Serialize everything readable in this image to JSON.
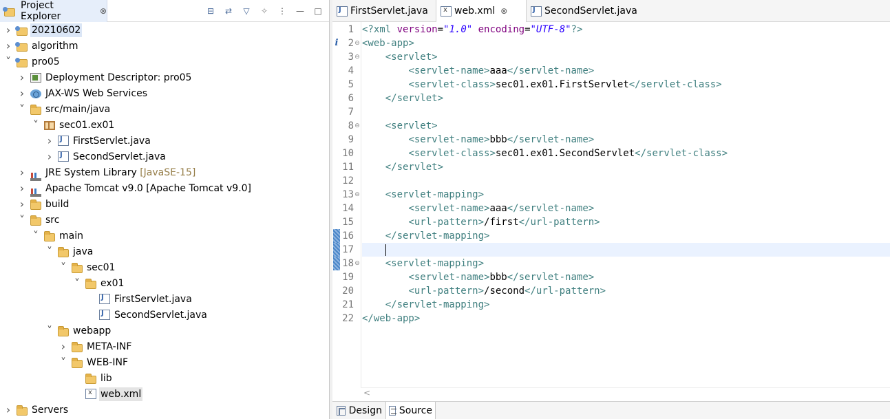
{
  "explorer": {
    "title": "Project Explorer",
    "close_glyph": "⊗",
    "toolbar": [
      "collapse-all-icon",
      "link-with-editor-icon",
      "filter-icon",
      "settings-icon",
      "view-menu-icon",
      "minimize-icon",
      "maximize-icon"
    ],
    "tree": [
      {
        "depth": 0,
        "chev": ">",
        "icon": "project",
        "label": "20210602",
        "sel": "blue"
      },
      {
        "depth": 0,
        "chev": ">",
        "icon": "project",
        "label": "algorithm"
      },
      {
        "depth": 0,
        "chev": "v",
        "icon": "project",
        "label": "pro05"
      },
      {
        "depth": 1,
        "chev": ">",
        "icon": "dd",
        "label": "Deployment Descriptor: pro05"
      },
      {
        "depth": 1,
        "chev": ">",
        "icon": "ws",
        "label": "JAX-WS Web Services"
      },
      {
        "depth": 1,
        "chev": "v",
        "icon": "folder",
        "label": "src/main/java"
      },
      {
        "depth": 2,
        "chev": "v",
        "icon": "pkg",
        "label": "sec01.ex01"
      },
      {
        "depth": 3,
        "chev": ">",
        "icon": "java",
        "label": "FirstServlet.java"
      },
      {
        "depth": 3,
        "chev": ">",
        "icon": "java",
        "label": "SecondServlet.java"
      },
      {
        "depth": 1,
        "chev": ">",
        "icon": "lib",
        "label": "JRE System Library",
        "decoration": "[JavaSE-15]"
      },
      {
        "depth": 1,
        "chev": ">",
        "icon": "lib",
        "label": "Apache Tomcat v9.0 [Apache Tomcat v9.0]"
      },
      {
        "depth": 1,
        "chev": ">",
        "icon": "folder",
        "label": "build"
      },
      {
        "depth": 1,
        "chev": "v",
        "icon": "folder",
        "label": "src"
      },
      {
        "depth": 2,
        "chev": "v",
        "icon": "folder",
        "label": "main"
      },
      {
        "depth": 3,
        "chev": "v",
        "icon": "folder",
        "label": "java"
      },
      {
        "depth": 4,
        "chev": "v",
        "icon": "folder",
        "label": "sec01"
      },
      {
        "depth": 5,
        "chev": "v",
        "icon": "folder",
        "label": "ex01"
      },
      {
        "depth": 6,
        "chev": "",
        "icon": "java",
        "label": "FirstServlet.java"
      },
      {
        "depth": 6,
        "chev": "",
        "icon": "java",
        "label": "SecondServlet.java"
      },
      {
        "depth": 3,
        "chev": "v",
        "icon": "folder",
        "label": "webapp"
      },
      {
        "depth": 4,
        "chev": ">",
        "icon": "folder",
        "label": "META-INF"
      },
      {
        "depth": 4,
        "chev": "v",
        "icon": "folder",
        "label": "WEB-INF"
      },
      {
        "depth": 5,
        "chev": "",
        "icon": "folder",
        "label": "lib"
      },
      {
        "depth": 5,
        "chev": "",
        "icon": "xml",
        "label": "web.xml",
        "sel": "grey"
      },
      {
        "depth": 0,
        "chev": ">",
        "icon": "folder",
        "label": "Servers"
      }
    ]
  },
  "editor": {
    "tabs": [
      {
        "label": "FirstServlet.java",
        "icon": "java",
        "active": false
      },
      {
        "label": "web.xml",
        "icon": "xml",
        "active": true
      },
      {
        "label": "SecondServlet.java",
        "icon": "java",
        "active": false
      }
    ],
    "close_glyph": "⊗",
    "current_line": 17,
    "lines": [
      [
        [
          "pi",
          "<?xml "
        ],
        [
          "attr",
          "version"
        ],
        [
          "txtc",
          "="
        ],
        [
          "val",
          "\"1.0\""
        ],
        [
          "txtc",
          " "
        ],
        [
          "attr",
          "encoding"
        ],
        [
          "txtc",
          "="
        ],
        [
          "val",
          "\"UTF-8\""
        ],
        [
          "pi",
          "?>"
        ]
      ],
      [
        [
          "tag",
          "<web-app>"
        ]
      ],
      [
        [
          "txtc",
          "    "
        ],
        [
          "tag",
          "<servlet>"
        ]
      ],
      [
        [
          "txtc",
          "        "
        ],
        [
          "tag",
          "<servlet-name>"
        ],
        [
          "txtc",
          "aaa"
        ],
        [
          "tag",
          "</servlet-name>"
        ]
      ],
      [
        [
          "txtc",
          "        "
        ],
        [
          "tag",
          "<servlet-class>"
        ],
        [
          "txtc",
          "sec01.ex01.FirstServlet"
        ],
        [
          "tag",
          "</servlet-class>"
        ]
      ],
      [
        [
          "txtc",
          "    "
        ],
        [
          "tag",
          "</servlet>"
        ]
      ],
      [
        [
          "txtc",
          " "
        ]
      ],
      [
        [
          "txtc",
          "    "
        ],
        [
          "tag",
          "<servlet>"
        ]
      ],
      [
        [
          "txtc",
          "        "
        ],
        [
          "tag",
          "<servlet-name>"
        ],
        [
          "txtc",
          "bbb"
        ],
        [
          "tag",
          "</servlet-name>"
        ]
      ],
      [
        [
          "txtc",
          "        "
        ],
        [
          "tag",
          "<servlet-class>"
        ],
        [
          "txtc",
          "sec01.ex01.SecondServlet"
        ],
        [
          "tag",
          "</servlet-class>"
        ]
      ],
      [
        [
          "txtc",
          "    "
        ],
        [
          "tag",
          "</servlet>"
        ]
      ],
      [
        [
          "txtc",
          " "
        ]
      ],
      [
        [
          "txtc",
          "    "
        ],
        [
          "tag",
          "<servlet-mapping>"
        ]
      ],
      [
        [
          "txtc",
          "        "
        ],
        [
          "tag",
          "<servlet-name>"
        ],
        [
          "txtc",
          "aaa"
        ],
        [
          "tag",
          "</servlet-name>"
        ]
      ],
      [
        [
          "txtc",
          "        "
        ],
        [
          "tag",
          "<url-pattern>"
        ],
        [
          "txtc",
          "/first"
        ],
        [
          "tag",
          "</url-pattern>"
        ]
      ],
      [
        [
          "txtc",
          "    "
        ],
        [
          "tag",
          "</servlet-mapping>"
        ]
      ],
      [
        [
          "txtc",
          "    "
        ]
      ],
      [
        [
          "txtc",
          "    "
        ],
        [
          "tag",
          "<servlet-mapping>"
        ]
      ],
      [
        [
          "txtc",
          "        "
        ],
        [
          "tag",
          "<servlet-name>"
        ],
        [
          "txtc",
          "bbb"
        ],
        [
          "tag",
          "</servlet-name>"
        ]
      ],
      [
        [
          "txtc",
          "        "
        ],
        [
          "tag",
          "<url-pattern>"
        ],
        [
          "txtc",
          "/second"
        ],
        [
          "tag",
          "</url-pattern>"
        ]
      ],
      [
        [
          "txtc",
          "    "
        ],
        [
          "tag",
          "</servlet-mapping>"
        ]
      ],
      [
        [
          "tag",
          "</web-app>"
        ]
      ]
    ],
    "fold_lines": [
      2,
      3,
      8,
      13,
      18
    ],
    "changed_lines": [
      16,
      17,
      18
    ],
    "info_line": 2,
    "bottom_tabs": [
      {
        "label": "Design",
        "active": false
      },
      {
        "label": "Source",
        "active": true
      }
    ],
    "scroll_arrow": "<"
  }
}
